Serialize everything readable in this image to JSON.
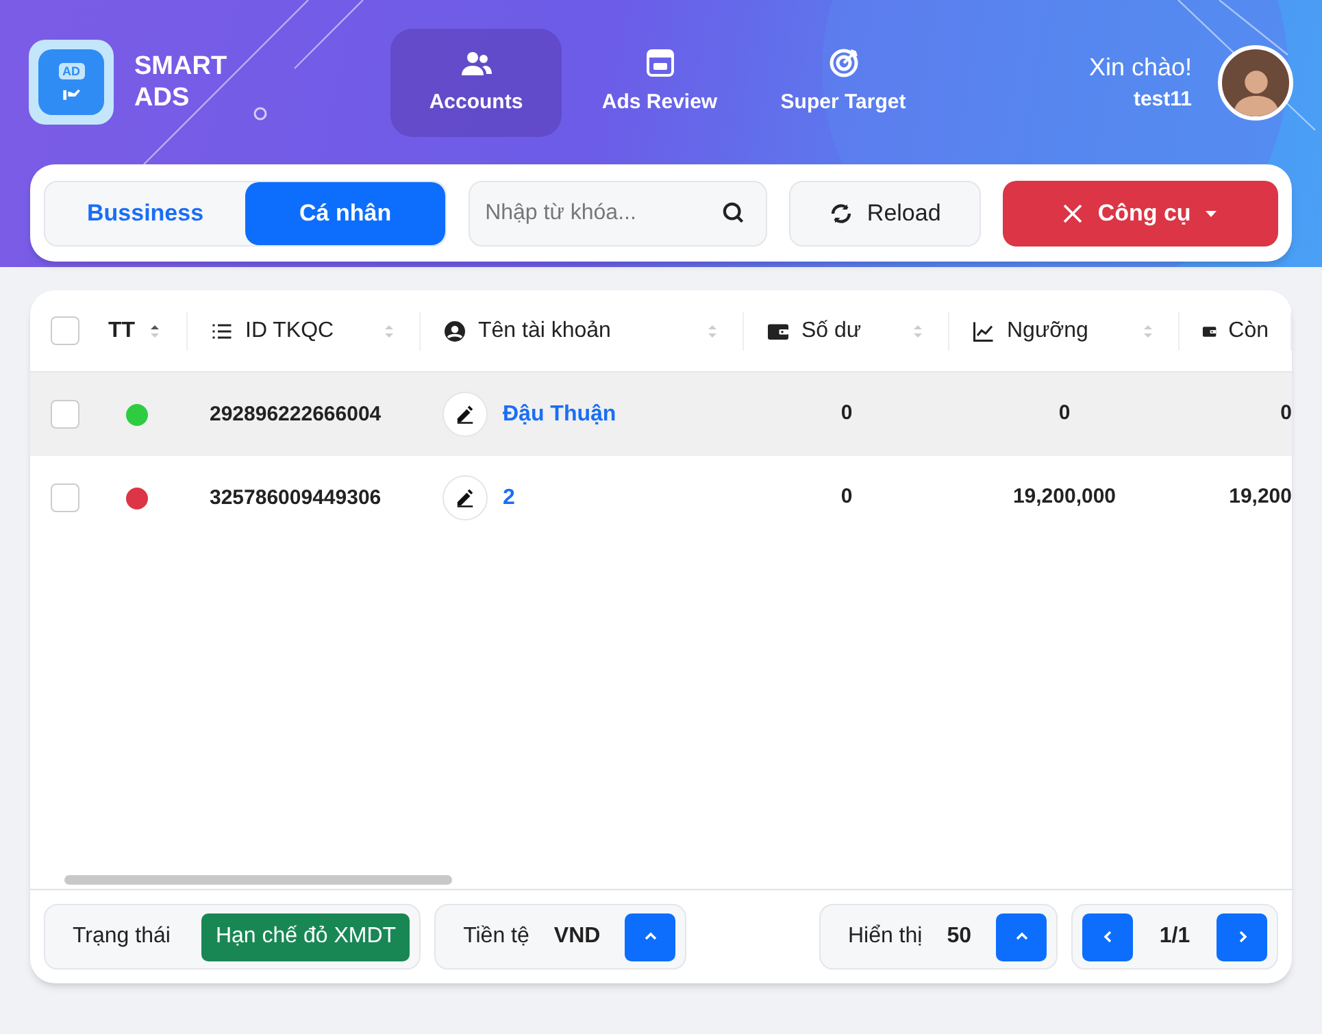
{
  "brand": {
    "logo_text": "AD",
    "name_line_1": "SMART",
    "name_line_2": "ADS"
  },
  "nav": [
    {
      "label": "Accounts",
      "selected": true
    },
    {
      "label": "Ads Review",
      "selected": false
    },
    {
      "label": "Super Target",
      "selected": false
    }
  ],
  "user": {
    "greeting": "Xin chào!",
    "username": "test11"
  },
  "toolbar": {
    "segments": [
      {
        "label": "Bussiness",
        "selected": false
      },
      {
        "label": "Cá nhân",
        "selected": true
      }
    ],
    "search": {
      "placeholder": "Nhập từ khóa..."
    },
    "reload": "Reload",
    "tools": "Công cụ"
  },
  "table": {
    "select_all_checked": false,
    "columns": [
      {
        "label": "TT"
      },
      {
        "label": "ID TKQC"
      },
      {
        "label": "Tên tài khoản"
      },
      {
        "label": "Số dư"
      },
      {
        "label": "Ngưỡng"
      },
      {
        "label": "Còn"
      }
    ],
    "rows": [
      {
        "selected": true,
        "checked": false,
        "color": "#2ecc40",
        "id": "292896222666004",
        "name": "Đậu Thuận",
        "balance": "0",
        "threshold": "0",
        "remaining": "0"
      },
      {
        "selected": false,
        "checked": false,
        "color": "#dc3545",
        "id": "325786009449306",
        "name": "2",
        "balance": "0",
        "threshold": "19,200,000",
        "remaining": "19,200"
      }
    ]
  },
  "footer": {
    "status_label": "Trạng thái",
    "status_value": "Hạn chế đỏ XMDT",
    "currency_label": "Tiền tệ",
    "currency_value": "VND",
    "show_label": "Hiển thị",
    "show_value": "50",
    "page": "1/1"
  }
}
